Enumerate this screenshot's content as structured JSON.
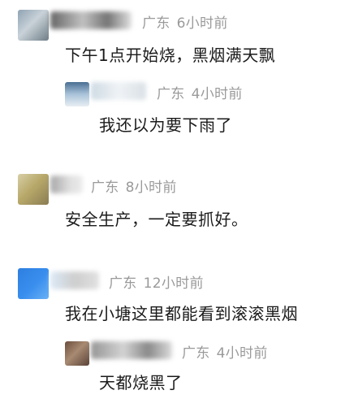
{
  "comments": [
    {
      "location": "广东",
      "time": "6小时前",
      "text": "下午1点开始烧，黑烟满天飘",
      "replies": [
        {
          "location": "广东",
          "time": "4小时前",
          "text": "我还以为要下雨了"
        }
      ]
    },
    {
      "location": "广东",
      "time": "8小时前",
      "text": "安全生产，一定要抓好。",
      "replies": []
    },
    {
      "location": "广东",
      "time": "12小时前",
      "text": "我在小塘这里都能看到滚滚黑烟",
      "replies": [
        {
          "location": "广东",
          "time": "4小时前",
          "text": "天都烧黑了"
        }
      ]
    }
  ]
}
